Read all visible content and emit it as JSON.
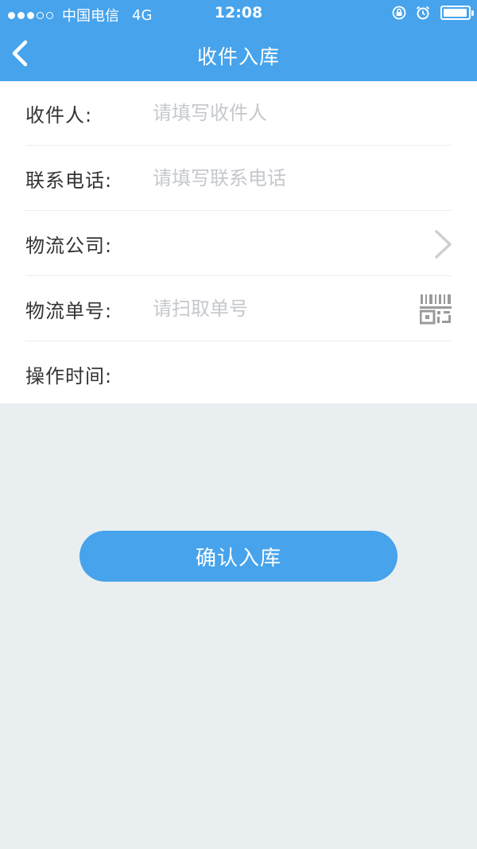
{
  "status_bar": {
    "signal_dots": [
      true,
      true,
      true,
      false,
      false
    ],
    "carrier": "中国电信",
    "network": "4G",
    "time": "12:08",
    "icons": [
      "rotation-lock-icon",
      "alarm-icon",
      "battery-icon"
    ],
    "battery_level": 0.95
  },
  "nav": {
    "back_icon": "chevron-left-icon",
    "title": "收件入库"
  },
  "form": {
    "recipient": {
      "label": "收件人:",
      "placeholder": "请填写收件人",
      "value": ""
    },
    "phone": {
      "label": "联系电话:",
      "placeholder": "请填写联系电话",
      "value": ""
    },
    "courier": {
      "label": "物流公司:",
      "value": "",
      "icon": "chevron-right-icon"
    },
    "tracking": {
      "label": "物流单号:",
      "placeholder": "请扫取单号",
      "value": "",
      "icon": "barcode-scan-icon"
    },
    "time": {
      "label": "操作时间:",
      "value": ""
    }
  },
  "confirm_button": "确认入库",
  "colors": {
    "primary": "#46a3ec",
    "background": "#e9eff0",
    "placeholder": "#c5c8cc",
    "label": "#333333"
  }
}
